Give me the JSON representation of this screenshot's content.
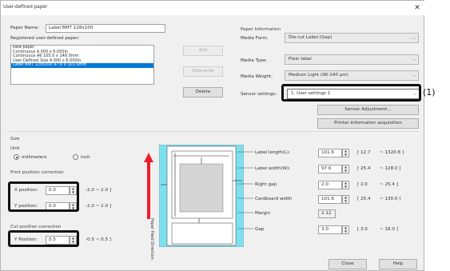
{
  "title": "User-defined paper",
  "paper_name": {
    "label": "Paper Name:",
    "value": "Label BMT 128x100"
  },
  "registered_label": "Registered user-defined paper:",
  "registered_list": [
    "New paper",
    "Continuous 4.000 x 6.000in",
    "Continuous A6 105.0 x 148.0mm",
    "User Defined Size 4.000 x 6.000in",
    "Label BMT 120x100 97.6 x 101.6mm"
  ],
  "buttons": {
    "add": "Add",
    "overwrite": "Overwrite",
    "delete": "Delete",
    "sensor_adjustment": "Sensor Adjustment...",
    "printer_info": "Printer information acquisition",
    "close": "Close",
    "help": "Help"
  },
  "paper_information": {
    "group": "Paper Information",
    "media_form_label": "Media Form:",
    "media_form": "Die-cut Label (Gap)",
    "media_type_label": "Media Type:",
    "media_type": "Plain label",
    "media_weight_label": "Media Weight:",
    "media_weight": "Medium Light (96-140 µm)",
    "sensor_label": "Sensor settings:",
    "sensor": "1. User settings 1"
  },
  "size": {
    "group": "Size",
    "unit_label": "Unit",
    "unit_mm": "millimeters",
    "unit_inch": "inch",
    "print_pos_group": "Print position correction",
    "x_label": "X position:",
    "x_value": "0.0",
    "y_label": "Y position:",
    "y_value": "0.0",
    "print_range": "-2.0  ~  2.0  ]",
    "cut_pos_group": "Cut position correction",
    "ycut_label": "Y Position:",
    "ycut_value": "0.5",
    "cut_range": "-0.5  ~  0.5  ]"
  },
  "diagram": {
    "feed_label": "Paper Feed Direction"
  },
  "dimensions": [
    {
      "label": "Label length(L):",
      "value": "101.6",
      "min": "[ 12.7",
      "max": "~ 1320.8  ]"
    },
    {
      "label": "Label width(W):",
      "value": "97.6",
      "min": "[ 25.4",
      "max": "~ 128.0  ]"
    },
    {
      "label": "Right gap",
      "value": "2.0",
      "min": "[ 2.0",
      "max": "~ 25.4  ]"
    },
    {
      "label": "Cardboard width",
      "value": "101.6",
      "min": "[ 25.4",
      "max": "~ 130.0  ]"
    },
    {
      "label": "Margin",
      "value": "2.12",
      "min": "",
      "max": ""
    },
    {
      "label": "Gap",
      "value": "3.0",
      "min": "[ 3.0",
      "max": "~ 18.0  ]"
    }
  ],
  "annotations": {
    "one": "(1)"
  },
  "colors": {
    "accent": "#0078d7",
    "diagram_bg": "#7ee0ee",
    "arrow": "#e8212b",
    "callout": "#111111"
  }
}
